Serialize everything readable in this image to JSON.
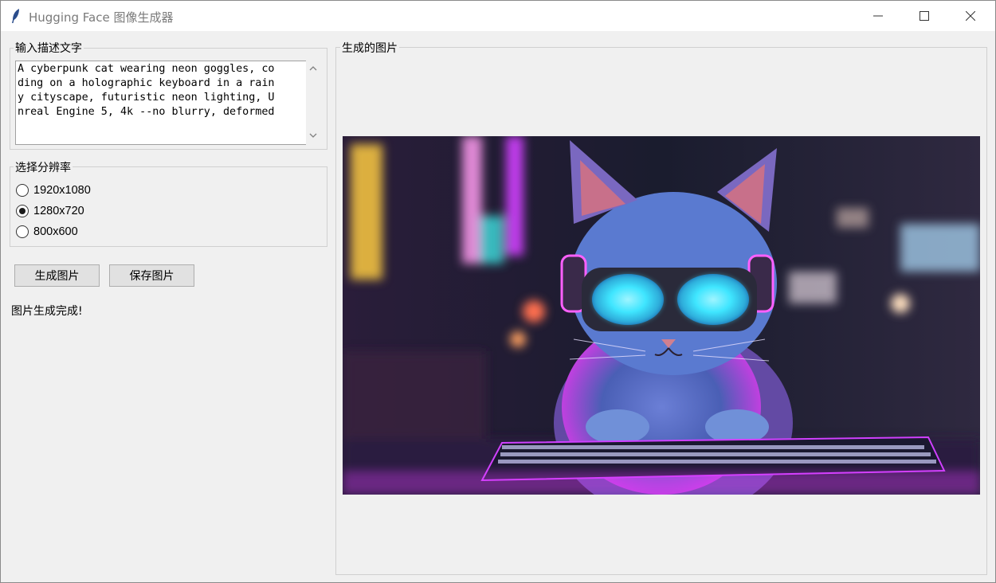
{
  "window": {
    "title": "Hugging Face 图像生成器",
    "app_icon": "feather-icon",
    "controls": [
      "minimize-icon",
      "maximize-icon",
      "close-icon"
    ]
  },
  "prompt_section": {
    "label": "输入描述文字",
    "lines": [
      "A cyberpunk cat wearing neon goggles, co",
      "ding on a holographic keyboard in a rain",
      "y cityscape, futuristic neon lighting, U",
      "nreal Engine 5, 4k --no blurry, deformed"
    ]
  },
  "resolution_section": {
    "label": "选择分辨率",
    "options": [
      {
        "label": "1920x1080",
        "selected": false
      },
      {
        "label": "1280x720",
        "selected": true
      },
      {
        "label": "800x600",
        "selected": false
      }
    ]
  },
  "buttons": {
    "generate": "生成图片",
    "save": "保存图片"
  },
  "status": "图片生成完成!",
  "image_section": {
    "label": "生成的图片",
    "image_subject": "cyberpunk-cat-image"
  },
  "colors": {
    "window_bg": "#f0f0f0",
    "titlebar_bg": "#ffffff",
    "button_bg": "#e1e1e1",
    "neon_pink": "#e23cff",
    "neon_cyan": "#3fe6ff"
  }
}
